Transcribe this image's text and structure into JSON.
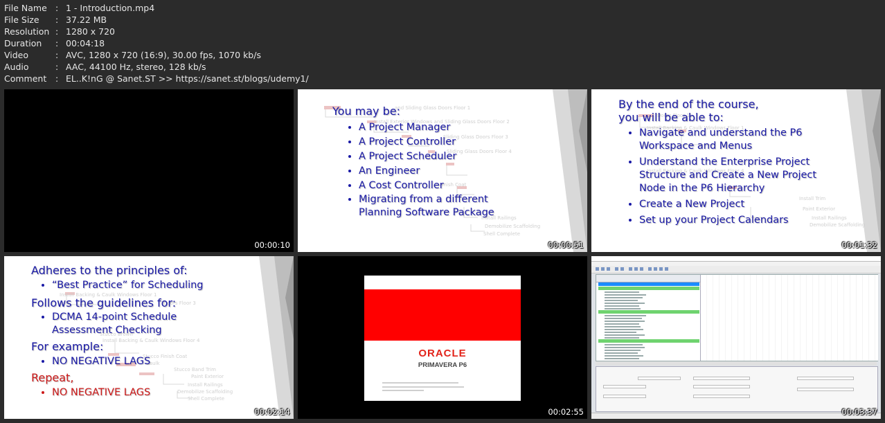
{
  "meta": [
    {
      "key": "File Name",
      "value": "1 - Introduction.mp4"
    },
    {
      "key": "File Size",
      "value": "37.22 MB"
    },
    {
      "key": "Resolution",
      "value": "1280 x 720"
    },
    {
      "key": "Duration",
      "value": "00:04:18"
    },
    {
      "key": "Video",
      "value": "AVC, 1280 x 720 (16:9), 30.00 fps, 1070 kb/s"
    },
    {
      "key": "Audio",
      "value": "AAC, 44100 Hz, stereo, 128 kb/s"
    },
    {
      "key": "Comment",
      "value": "EL..K!nG @ Sanet.ST >> https://sanet.st/blogs/udemy1/"
    }
  ],
  "thumbs": {
    "t1": {
      "time": "00:00:10"
    },
    "t2": {
      "time": "00:00:51",
      "heading": "You may be:",
      "items": [
        "A Project Manager",
        "A Project Controller",
        "A Project Scheduler",
        "An Engineer",
        "A Cost Controller",
        "Migrating from a different Planning Software Package"
      ]
    },
    "t3": {
      "time": "00:01:32",
      "heading1": "By the end of the course,",
      "heading2": "you will be able to:",
      "items": [
        "Navigate and understand the P6 Workspace and Menus",
        "Understand the Enterprise Project Structure and Create a New Project Node in the P6 Hierarchy",
        "Create a New Project",
        "Set up your Project Calendars"
      ]
    },
    "t4": {
      "time": "00:02:14",
      "h1": "Adheres to the principles of:",
      "i1": "“Best Practice” for Scheduling",
      "h2": "Follows the guidelines for:",
      "i2": "DCMA 14-point Schedule Assessment Checking",
      "h3": "For example:",
      "i3": "NO NEGATIVE LAGS",
      "h4": "Repeat,",
      "i4": "NO NEGATIVE LAGS"
    },
    "t5": {
      "time": "00:02:55",
      "logo": "ORACLE",
      "product": "PRIMAVERA P6"
    },
    "t6": {
      "time": "00:03:37"
    }
  },
  "colors": {
    "slide_text": "#1a1aa6",
    "repeat_red": "#cc1a1a",
    "oracle_red": "#ff0000"
  }
}
